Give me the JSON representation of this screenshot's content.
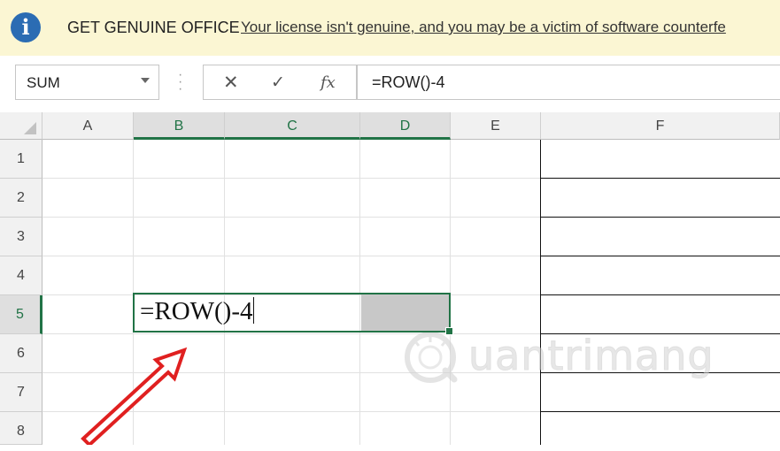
{
  "message_bar": {
    "icon": "info-icon",
    "icon_glyph": "i",
    "title": "GET GENUINE OFFICE",
    "link_text": "Your license isn't genuine, and you may be a victim of software counterfe"
  },
  "formula_bar": {
    "name_box": "SUM",
    "cancel_glyph": "✕",
    "enter_glyph": "✓",
    "fx_glyph": "fx",
    "formula": "=ROW()-4"
  },
  "grid": {
    "columns": [
      "A",
      "B",
      "C",
      "D",
      "E",
      "F"
    ],
    "rows": [
      "1",
      "2",
      "3",
      "4",
      "5",
      "6",
      "7",
      "8"
    ],
    "selected_columns": [
      "B",
      "C",
      "D"
    ],
    "selected_row": "5",
    "active_cell_text": "=ROW()-4"
  },
  "watermark": {
    "text": "uantrimang"
  },
  "colors": {
    "accent": "#217346",
    "message_bar_bg": "#fbf6d3",
    "info_icon": "#2b6cb3",
    "arrow": "#e02020"
  }
}
